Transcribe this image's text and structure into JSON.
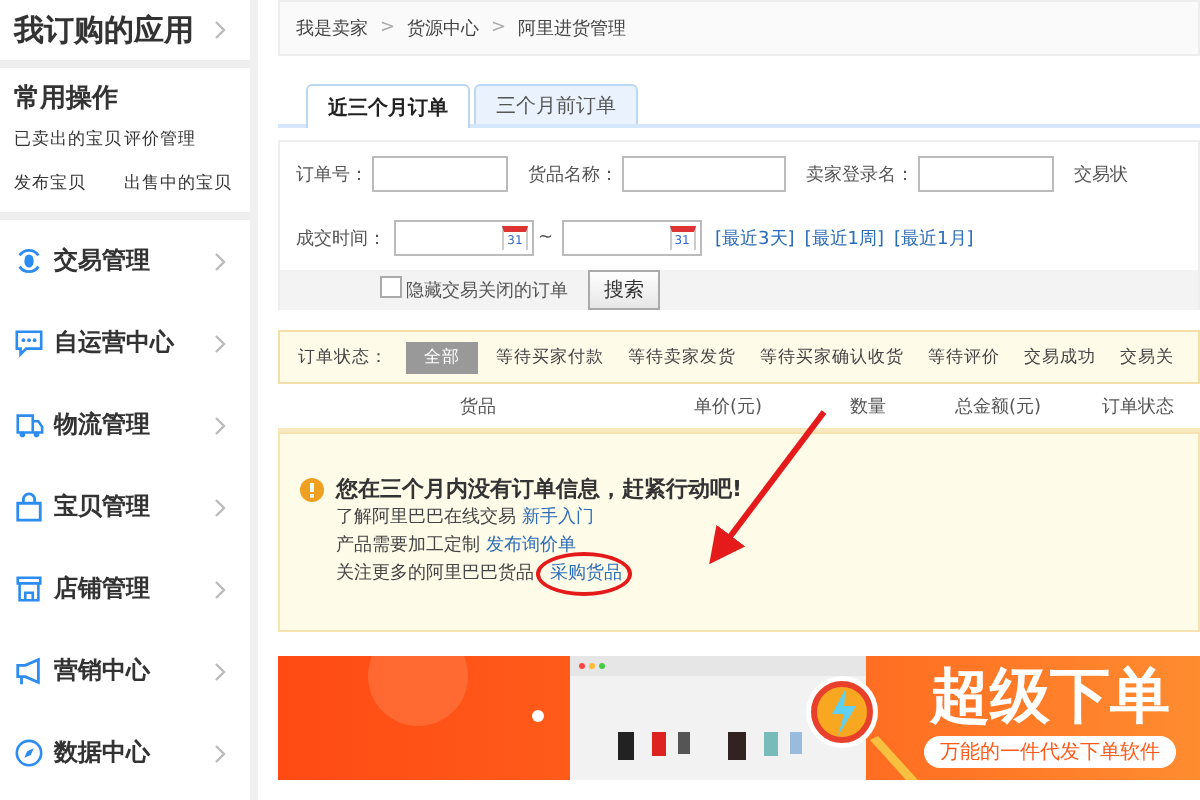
{
  "sidebar": {
    "title": "我订购的应用",
    "common": {
      "title": "常用操作",
      "links": [
        "已卖出的宝贝",
        "评价管理",
        "发布宝贝",
        "出售中的宝贝"
      ]
    },
    "items": [
      {
        "label": "交易管理"
      },
      {
        "label": "自运营中心"
      },
      {
        "label": "物流管理"
      },
      {
        "label": "宝贝管理"
      },
      {
        "label": "店铺管理"
      },
      {
        "label": "营销中心"
      },
      {
        "label": "数据中心"
      }
    ]
  },
  "breadcrumb": [
    "我是卖家",
    "货源中心",
    "阿里进货管理"
  ],
  "breadcrumb_separator": ">",
  "tabs": [
    {
      "label": "近三个月订单",
      "selected": true
    },
    {
      "label": "三个月前订单",
      "selected": false
    }
  ],
  "filters": {
    "fields": [
      "订单号：",
      "货品名称：",
      "卖家登录名："
    ],
    "cut_label": "交易状",
    "date_label": "成交时间：",
    "date_separator": "~",
    "calendar_days": [
      "31",
      "31"
    ],
    "quick_ranges": [
      "[最近3天]",
      "[最近1周]",
      "[最近1月]"
    ],
    "hide_closed": {
      "label": "隐藏交易关闭的订单",
      "checked": false
    },
    "search_button": "搜索"
  },
  "status_filter": {
    "label": "订单状态：",
    "items": [
      {
        "label": "全部",
        "selected": true
      },
      {
        "label": "等待买家付款",
        "selected": false
      },
      {
        "label": "等待卖家发货",
        "selected": false
      },
      {
        "label": "等待买家确认收货",
        "selected": false
      },
      {
        "label": "等待评价",
        "selected": false
      },
      {
        "label": "交易成功",
        "selected": false
      },
      {
        "label": "交易关",
        "selected": false
      }
    ]
  },
  "columns": [
    "货品",
    "单价(元)",
    "数量",
    "总金额(元)",
    "订单状态"
  ],
  "empty_notice": {
    "title": "您在三个月内没有订单信息，赶紧行动吧!",
    "lines": [
      {
        "text": "了解阿里巴巴在线交易",
        "link": "新手入门"
      },
      {
        "text": "产品需要加工定制",
        "link": "发布询价单"
      },
      {
        "text": "关注更多的阿里巴巴货品",
        "link": "采购货品"
      }
    ]
  },
  "banner": {
    "title": "超级下单",
    "subtitle": "万能的一件代发下单软件"
  }
}
